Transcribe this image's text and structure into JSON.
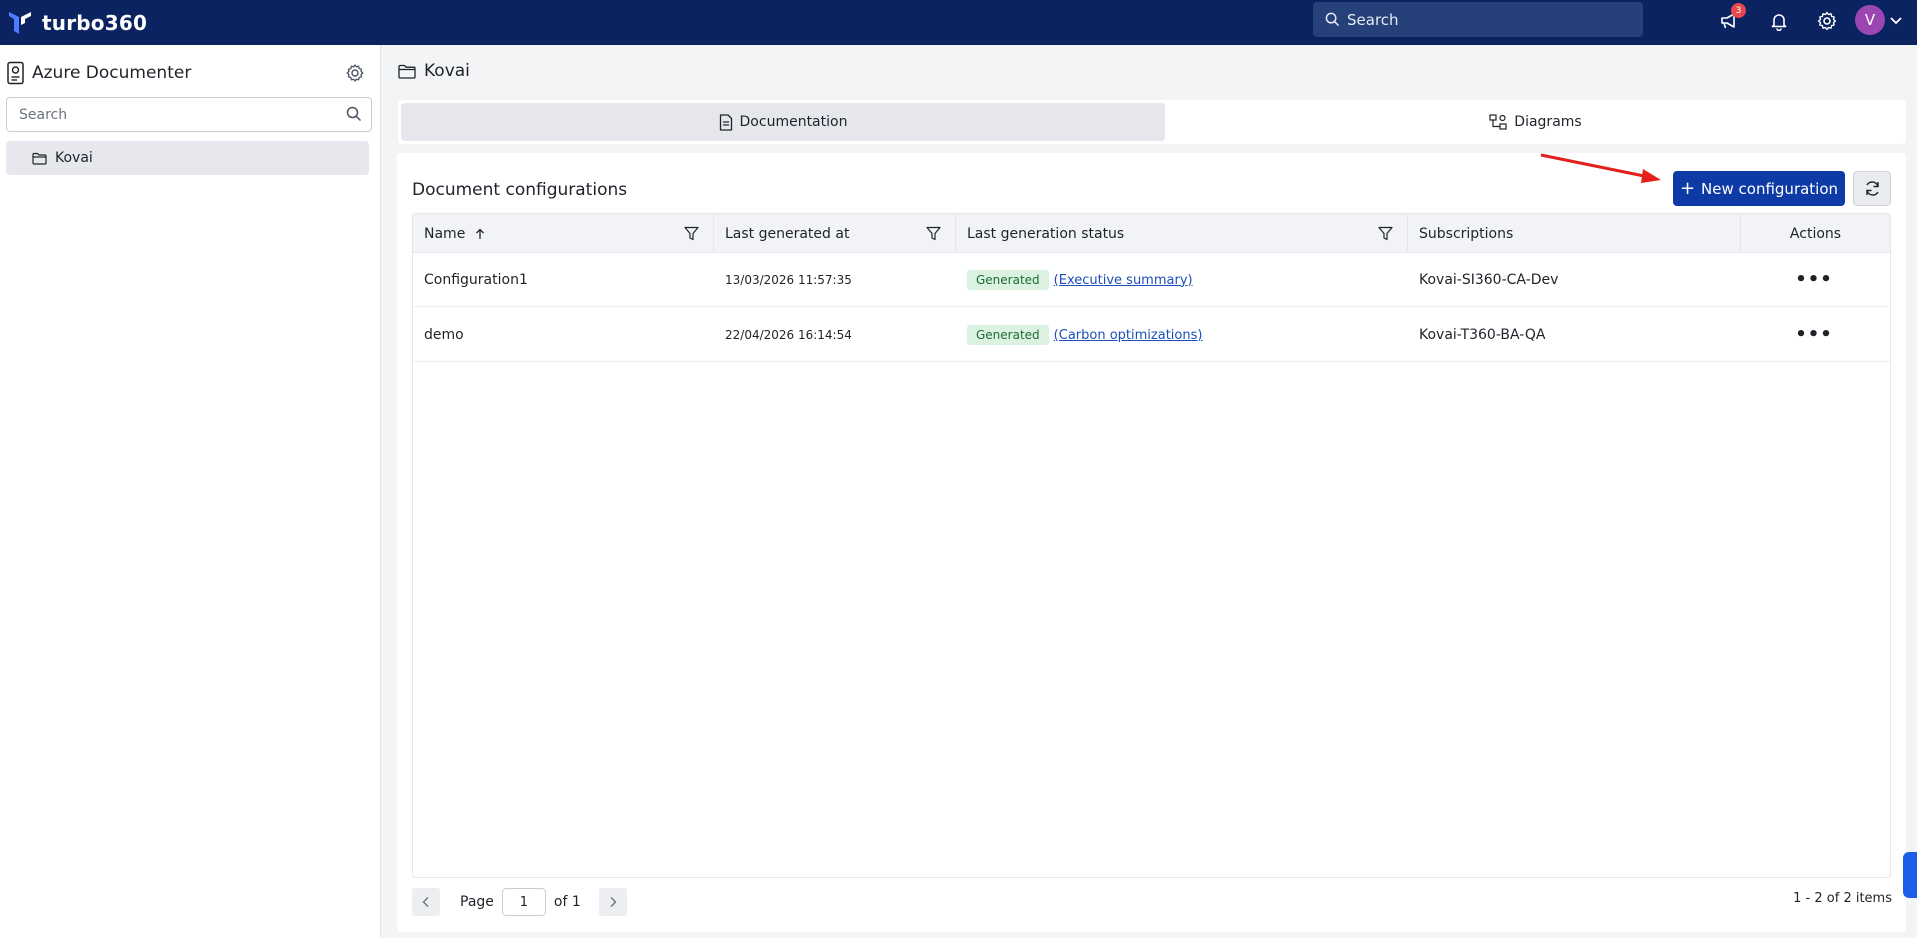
{
  "app": {
    "brand_name": "turbo360",
    "search_placeholder": "Search",
    "notification_count": "3",
    "avatar_initial": "V"
  },
  "sidebar": {
    "title": "Azure Documenter",
    "search_placeholder": "Search",
    "tree": [
      {
        "label": "Kovai",
        "selected": true
      }
    ]
  },
  "breadcrumb": {
    "label": "Kovai"
  },
  "tabs": [
    {
      "label": "Documentation",
      "active": true
    },
    {
      "label": "Diagrams",
      "active": false
    }
  ],
  "panel": {
    "title": "Document configurations",
    "new_button": "New configuration"
  },
  "table": {
    "columns": [
      "Name",
      "Last generated at",
      "Last generation status",
      "Subscriptions",
      "Actions"
    ],
    "rows": [
      {
        "name": "Configuration1",
        "last_generated": "13/03/2026 11:57:35",
        "status": "Generated",
        "report": "(Executive summary)",
        "subscription": "Kovai-SI360-CA-Dev"
      },
      {
        "name": "demo",
        "last_generated": "22/04/2026 16:14:54",
        "status": "Generated",
        "report": "(Carbon optimizations)",
        "subscription": "Kovai-T360-BA-QA"
      }
    ]
  },
  "pager": {
    "page_label": "Page",
    "page_value": "1",
    "of_label": "of 1",
    "items_summary": "1 - 2 of 2 items"
  },
  "colors": {
    "topbar": "#0b2461",
    "primary_button": "#0e3aa6",
    "status_badge_bg": "#dbf2e1",
    "notification_badge": "#e5484d",
    "avatar_bg": "#9b46b3"
  },
  "icons": [
    "turbo360-logo-icon",
    "search-icon",
    "announcement-icon",
    "bell-icon",
    "gear-icon",
    "chevron-down-icon",
    "documenter-icon",
    "folder-icon",
    "document-icon",
    "diagram-icon",
    "refresh-icon",
    "filter-icon",
    "sort-asc-icon",
    "more-icon",
    "chevron-left-icon",
    "chevron-right-icon"
  ]
}
